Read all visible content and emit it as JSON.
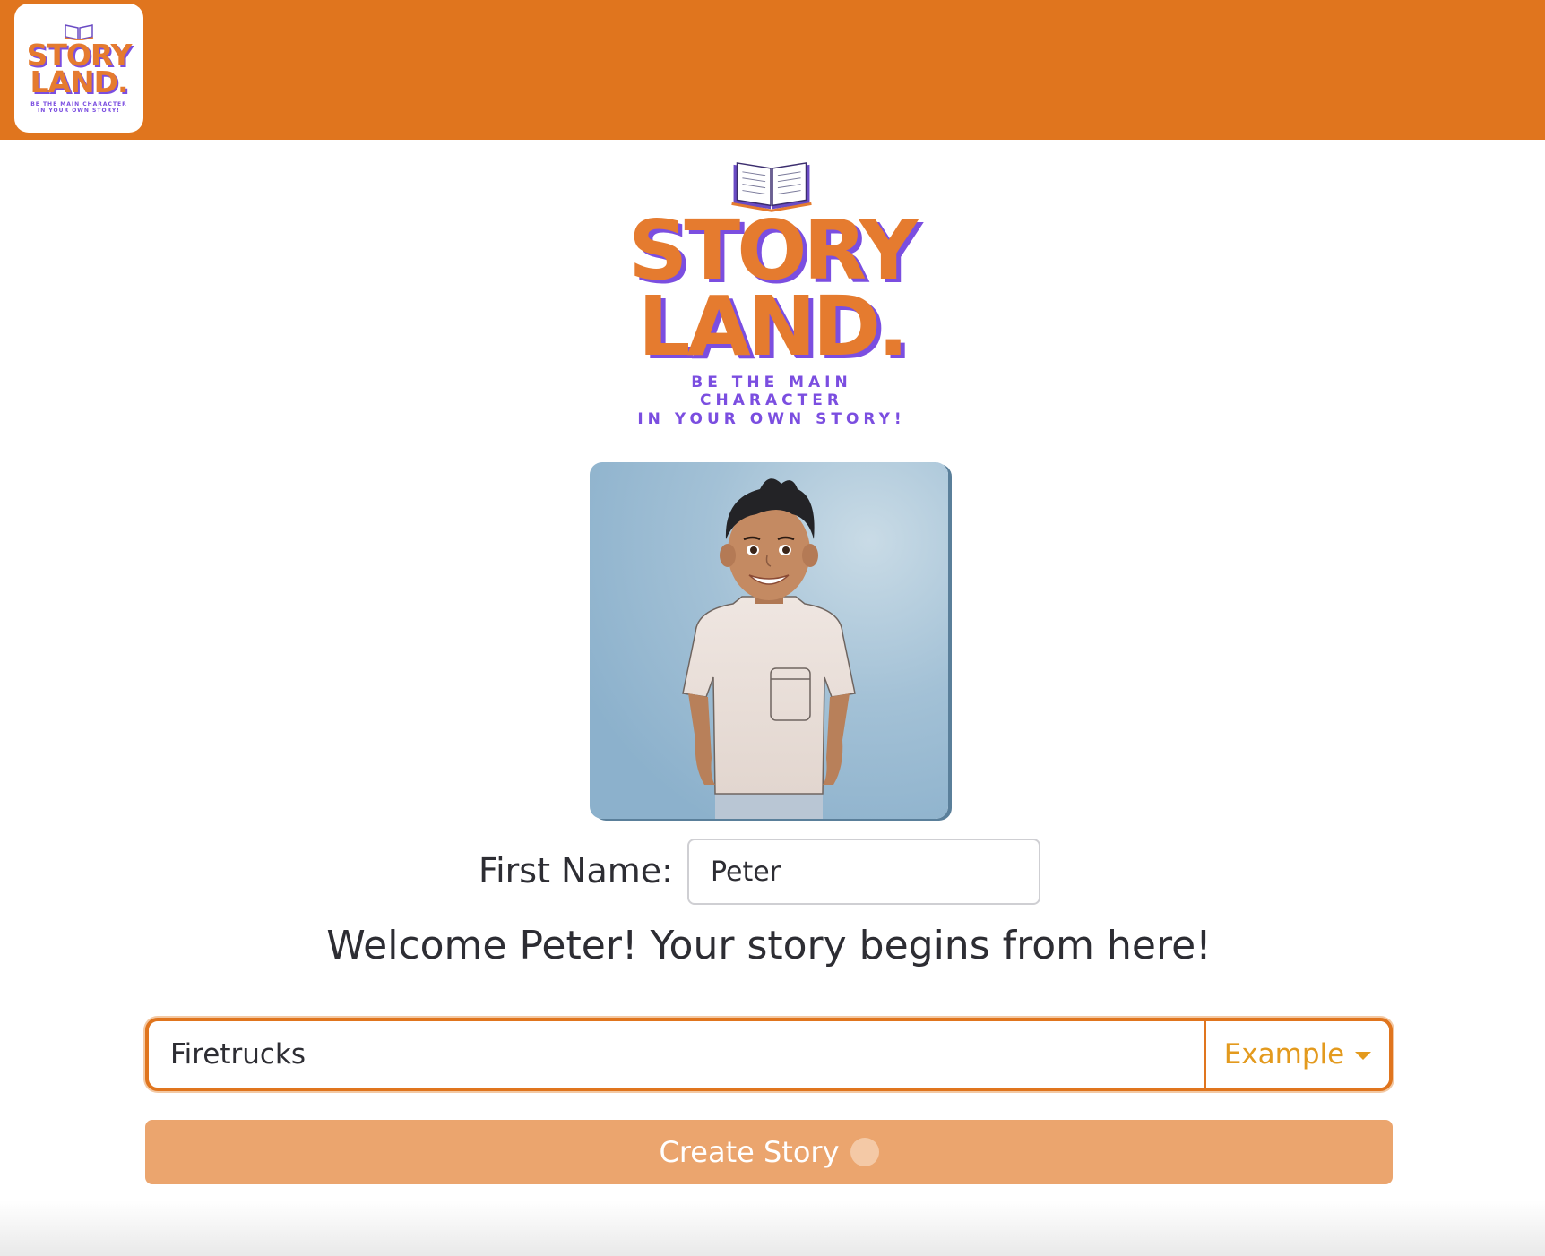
{
  "brand": {
    "word1": "STORY",
    "word2": "LAND.",
    "tagline_line1": "BE THE MAIN CHARACTER",
    "tagline_line2": "IN YOUR OWN STORY!"
  },
  "form": {
    "first_name_label": "First Name:",
    "first_name_value": "Peter",
    "welcome_text": "Welcome Peter! Your story begins from here!",
    "topic_value": "Firetrucks",
    "example_button_label": "Example",
    "create_button_label": "Create Story"
  },
  "colors": {
    "nav_bg": "#e0751e",
    "brand_orange": "#e57b2f",
    "brand_purple": "#7b4ee0",
    "button_bg": "#eba56e"
  },
  "icons": {
    "book": "open-book-icon",
    "dropdown": "caret-down-icon",
    "spinner": "loading-spinner-icon"
  }
}
